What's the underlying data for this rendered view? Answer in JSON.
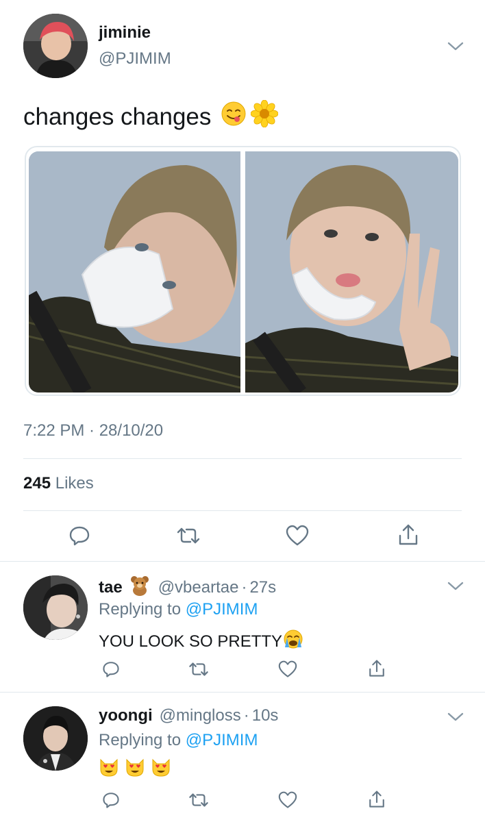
{
  "main_tweet": {
    "display_name": "jiminie",
    "handle": "@PJIMIM",
    "text": "changes changes",
    "text_emojis": [
      "yum-face",
      "blossom"
    ],
    "timestamp": "7:22 PM · 28/10/20",
    "likes_count": "245",
    "likes_label": "Likes",
    "photos": [
      "photo-left",
      "photo-right"
    ]
  },
  "replies": [
    {
      "display_name": "tae",
      "name_emoji": "bear",
      "handle": "@vbeartae",
      "separator": "·",
      "time": "27s",
      "replying_prefix": "Replying to",
      "replying_to": "@PJIMIM",
      "text": "YOU LOOK SO PRETTY",
      "text_emojis": [
        "loudly-crying-face"
      ]
    },
    {
      "display_name": "yoongi",
      "handle": "@mingloss",
      "separator": "·",
      "time": "10s",
      "replying_prefix": "Replying to",
      "replying_to": "@PJIMIM",
      "text": "",
      "text_emojis": [
        "heart-eyes-cat",
        "heart-eyes-cat",
        "heart-eyes-cat"
      ]
    }
  ],
  "colors": {
    "text": "#14171a",
    "secondary": "#657786",
    "link": "#1da1f2",
    "divider": "#e1e8ed",
    "icon": "#657786"
  }
}
